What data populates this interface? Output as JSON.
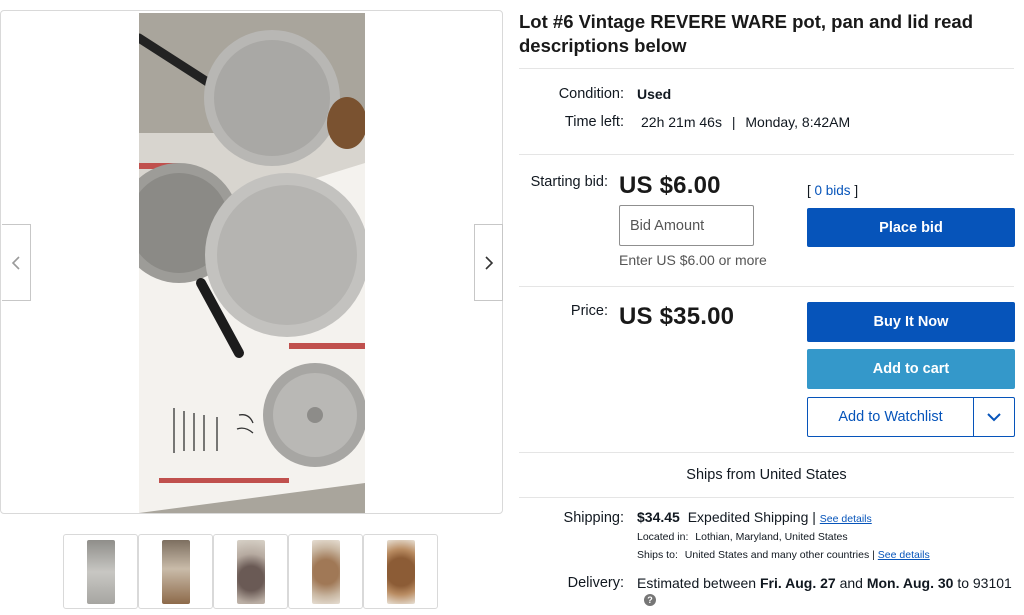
{
  "listing": {
    "title": "Lot #6 Vintage REVERE WARE pot, pan and lid read descriptions below"
  },
  "gallery": {
    "thumb_count": 5,
    "thumb_colors": [
      "#b5b4b0",
      "#9d8b76",
      "#8b7866",
      "#b0977d",
      "#9a6a45"
    ]
  },
  "details": {
    "condition_label": "Condition:",
    "condition_value": "Used",
    "time_left_label": "Time left:",
    "time_left_value": "22h 21m 46s",
    "time_left_sep": "|",
    "time_left_end": "Monday, 8:42AM"
  },
  "bidding": {
    "starting_bid_label": "Starting bid:",
    "starting_bid_value": "US $6.00",
    "bid_input_placeholder": "Bid Amount",
    "bid_hint": "Enter US $6.00 or more",
    "bids_open": "[",
    "bids_count": "0 bids",
    "bids_close": "]",
    "place_bid_label": "Place bid"
  },
  "buy": {
    "price_label": "Price:",
    "price_value": "US $35.00",
    "buy_now_label": "Buy It Now",
    "add_to_cart_label": "Add to cart",
    "watchlist_label": "Add to Watchlist"
  },
  "shipping": {
    "ships_from": "Ships from United States",
    "shipping_label": "Shipping:",
    "shipping_cost": "$34.45",
    "shipping_method": "Expedited Shipping",
    "shipping_sep": "|",
    "see_details": "See details",
    "located_label": "Located in:",
    "located_value": "Lothian, Maryland, United States",
    "ships_to_label": "Ships to:",
    "ships_to_value": "United States and many other countries",
    "ships_to_sep": "|",
    "ships_to_details": "See details",
    "delivery_label": "Delivery:",
    "delivery_prefix": "Estimated between",
    "delivery_start": "Fri. Aug. 27",
    "delivery_and": "and",
    "delivery_end": "Mon. Aug. 30",
    "delivery_to": "to 93101",
    "help_glyph": "?"
  },
  "colors": {
    "primary_blue": "#0654ba",
    "cart_blue": "#3498ca"
  }
}
